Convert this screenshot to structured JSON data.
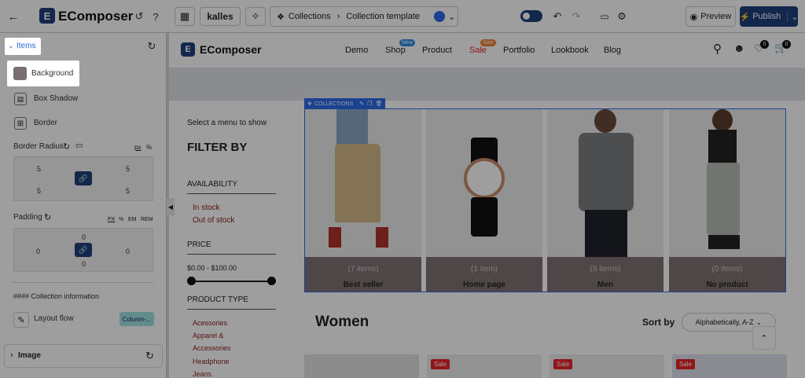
{
  "app": {
    "name": "EComposer",
    "theme": "kalles"
  },
  "breadcrumb": {
    "parent": "Collections",
    "current": "Collection template"
  },
  "toolbar": {
    "preview": "Preview",
    "publish": "Publish"
  },
  "sidebar": {
    "items_label": "Items",
    "background": "Background",
    "box_shadow": "Box Shadow",
    "border": "Border",
    "border_radius": "Border Radius",
    "radius_unit": "px",
    "radius_pct": "%",
    "radius_values": [
      "5",
      "5",
      "5",
      "5"
    ],
    "padding": "Padding",
    "padding_units": [
      "PX",
      "%",
      "EM",
      "REM"
    ],
    "padding_values": [
      "0",
      "0",
      "0",
      "0"
    ],
    "collection_info": "#### Collection information",
    "layout_flow": "Layout flow",
    "layout_flow_value": "Column-...",
    "image": "Image"
  },
  "site": {
    "logo": "EComposer",
    "nav": [
      "Demo",
      "Shop",
      "Product",
      "Sale",
      "Portfolio",
      "Lookbook",
      "Blog"
    ],
    "nav_badges": {
      "shop": "New",
      "sale": "Sale"
    },
    "wishlist_count": "0",
    "cart_count": "0"
  },
  "filter": {
    "menu_hint": "Select a menu to show",
    "title": "FILTER BY",
    "availability": "AVAILABILITY",
    "availability_items": [
      "In stock",
      "Out of stock"
    ],
    "price": "PRICE",
    "price_range": "$0.00 - $100.00",
    "product_type": "PRODUCT TYPE",
    "types": [
      "Acessories",
      "Apparel &",
      "Accessories",
      "Headphone",
      "Jeans"
    ]
  },
  "collections_label": "COLLECTIONS",
  "collections": [
    {
      "count": "(7 items)",
      "name": "Best seller"
    },
    {
      "count": "(1 item)",
      "name": "Home page"
    },
    {
      "count": "(5 items)",
      "name": "Men"
    },
    {
      "count": "(0 items)",
      "name": "No product"
    }
  ],
  "women": {
    "title": "Women",
    "sort_label": "Sort by",
    "sort_value": "Alphabetically, A-Z",
    "sale_badge": "Sale"
  },
  "colors": {
    "publish": "#1d3f7a",
    "accent": "#2a6be8",
    "caption": "#7e7273",
    "sale": "#e8242a",
    "filter_link": "#8a2020"
  }
}
